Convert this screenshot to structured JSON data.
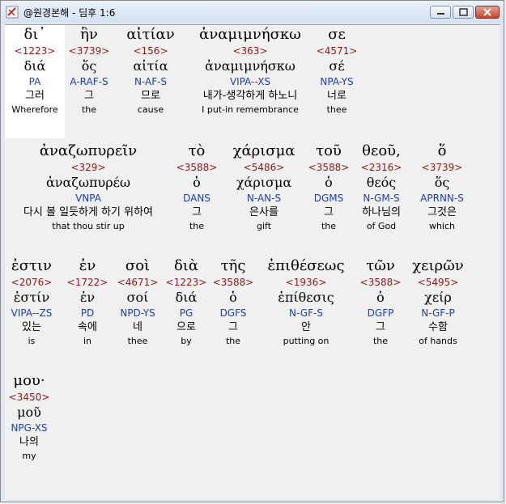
{
  "window": {
    "title": "@원경본해 - 딤후 1:6"
  },
  "rows": [
    [
      {
        "greek": "δι᾽",
        "strong": "<1223>",
        "lemma": "διά",
        "parse": "PA",
        "korean": "그러",
        "english": "Wherefore"
      },
      {
        "greek": "ἣν",
        "strong": "<3739>",
        "lemma": "ὅς",
        "parse": "A-RAF-S",
        "korean": "그",
        "english": "the"
      },
      {
        "greek": "αἰτίαν",
        "strong": "<156>",
        "lemma": "αἰτία",
        "parse": "N-AF-S",
        "korean": "므로",
        "english": "cause"
      },
      {
        "greek": "ἀναμιμνήσκω",
        "strong": "<363>",
        "lemma": "ἀναμιμνήσκω",
        "parse": "VIPA--XS",
        "korean": "내가-생각하게 하노니",
        "english": "I put-in remembrance"
      },
      {
        "greek": "σε",
        "strong": "<4571>",
        "lemma": "σέ",
        "parse": "NPA-YS",
        "korean": "너로",
        "english": "thee"
      }
    ],
    [
      {
        "greek": "ἀναζωπυρεῖν",
        "strong": "<329>",
        "lemma": "ἀναζωπυρέω",
        "parse": "VNPA",
        "korean": "다시 볼 일듯하게 하기 위하여",
        "english": "that thou stir up"
      },
      {
        "greek": "τὸ",
        "strong": "<3588>",
        "lemma": "ὁ",
        "parse": "DANS",
        "korean": "그",
        "english": "the"
      },
      {
        "greek": "χάρισμα",
        "strong": "<5486>",
        "lemma": "χάρισμα",
        "parse": "N-AN-S",
        "korean": "은사를",
        "english": "gift"
      },
      {
        "greek": "τοῦ",
        "strong": "<3588>",
        "lemma": "ὁ",
        "parse": "DGMS",
        "korean": "그",
        "english": "the"
      },
      {
        "greek": "θεοῦ,",
        "strong": "<2316>",
        "lemma": "θεός",
        "parse": "N-GM-S",
        "korean": "하나님의",
        "english": "of God"
      },
      {
        "greek": "ὅ",
        "strong": "<3739>",
        "lemma": "ὅς",
        "parse": "APRNN-S",
        "korean": "그것은",
        "english": "which"
      }
    ],
    [
      {
        "greek": "ἐστιν",
        "strong": "<2076>",
        "lemma": "ἐστίν",
        "parse": "VIPA--ZS",
        "korean": "있는",
        "english": "is"
      },
      {
        "greek": "ἐν",
        "strong": "<1722>",
        "lemma": "ἐν",
        "parse": "PD",
        "korean": "속에",
        "english": "in"
      },
      {
        "greek": "σοὶ",
        "strong": "<4671>",
        "lemma": "σοί",
        "parse": "NPD-YS",
        "korean": "네",
        "english": "thee"
      },
      {
        "greek": "διὰ",
        "strong": "<1223>",
        "lemma": "διά",
        "parse": "PG",
        "korean": "으로",
        "english": "by"
      },
      {
        "greek": "τῆς",
        "strong": "<3588>",
        "lemma": "ὁ",
        "parse": "DGFS",
        "korean": "그",
        "english": "the"
      },
      {
        "greek": "ἐπιθέσεως",
        "strong": "<1936>",
        "lemma": "ἐπίθεσις",
        "parse": "N-GF-S",
        "korean": "안",
        "english": "putting on"
      },
      {
        "greek": "τῶν",
        "strong": "<3588>",
        "lemma": "ὁ",
        "parse": "DGFP",
        "korean": "그",
        "english": "the"
      },
      {
        "greek": "χειρῶν",
        "strong": "<5495>",
        "lemma": "χείρ",
        "parse": "N-GF-P",
        "korean": "수함",
        "english": "of hands"
      }
    ],
    [
      {
        "greek": "μου·",
        "strong": "<3450>",
        "lemma": "μοῦ",
        "parse": "NPG-XS",
        "korean": "나의",
        "english": "my"
      }
    ]
  ]
}
